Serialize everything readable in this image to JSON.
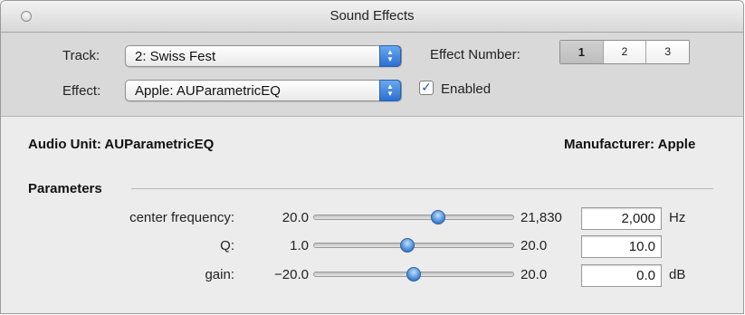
{
  "window": {
    "title": "Sound Effects"
  },
  "track": {
    "label": "Track:",
    "value": "2: Swiss Fest"
  },
  "effect": {
    "label": "Effect:",
    "value": "Apple: AUParametricEQ"
  },
  "effect_number": {
    "label": "Effect Number:",
    "options": [
      "1",
      "2",
      "3"
    ],
    "selected": "1"
  },
  "enabled": {
    "label": "Enabled",
    "checked": true
  },
  "info": {
    "audio_unit": "Audio Unit: AUParametricEQ",
    "manufacturer": "Manufacturer: Apple"
  },
  "parameters": {
    "heading": "Parameters",
    "items": [
      {
        "label": "center frequency:",
        "min": "20.0",
        "max": "21,830",
        "value": "2,000",
        "unit": "Hz",
        "level": 0.62
      },
      {
        "label": "Q:",
        "min": "1.0",
        "max": "20.0",
        "value": "10.0",
        "unit": "",
        "level": 0.47
      },
      {
        "label": "gain:",
        "min": "−20.0",
        "max": "20.0",
        "value": "0.0",
        "unit": "dB",
        "level": 0.5
      }
    ]
  }
}
